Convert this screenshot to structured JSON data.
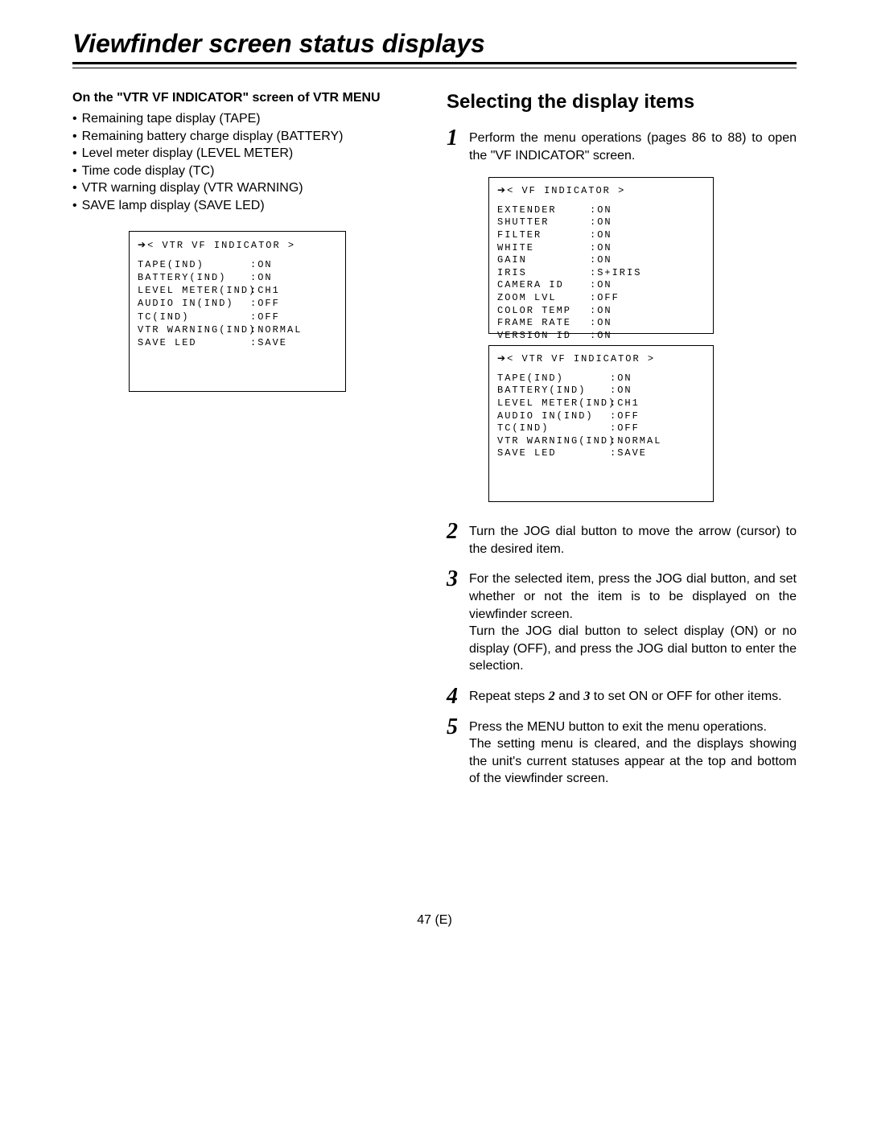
{
  "title": "Viewfinder screen status displays",
  "left": {
    "heading": "On the \"VTR VF INDICATOR\" screen of VTR MENU",
    "bullets": [
      "Remaining tape display (TAPE)",
      "Remaining battery charge display (BATTERY)",
      "Level meter display (LEVEL METER)",
      "Time code display (TC)",
      "VTR warning display (VTR WARNING)",
      "SAVE lamp display (SAVE LED)"
    ],
    "menu": {
      "title": "< VTR VF INDICATOR >",
      "rows": [
        {
          "l": "TAPE(IND)",
          "v": ":ON"
        },
        {
          "l": "BATTERY(IND)",
          "v": ":ON"
        },
        {
          "l": "LEVEL METER(IND)",
          "v": ":CH1"
        },
        {
          "l": "AUDIO IN(IND)",
          "v": ":OFF"
        },
        {
          "l": "TC(IND)",
          "v": ":OFF"
        },
        {
          "l": "VTR WARNING(IND)",
          "v": ":NORMAL"
        },
        {
          "l": "SAVE LED",
          "v": ":SAVE"
        }
      ]
    }
  },
  "right": {
    "heading": "Selecting the display items",
    "step1": "Perform the menu operations (pages 86 to 88) to open the \"VF INDICATOR\" screen.",
    "menu1": {
      "title": "< VF INDICATOR >",
      "rows": [
        {
          "l": "EXTENDER",
          "v": ":ON"
        },
        {
          "l": "SHUTTER",
          "v": ":ON"
        },
        {
          "l": "FILTER",
          "v": ":ON"
        },
        {
          "l": "WHITE",
          "v": ":ON"
        },
        {
          "l": "GAIN",
          "v": ":ON"
        },
        {
          "l": "IRIS",
          "v": ":S+IRIS"
        },
        {
          "l": "CAMERA ID",
          "v": ":ON"
        },
        {
          "l": "ZOOM LVL",
          "v": ":OFF"
        },
        {
          "l": "COLOR TEMP",
          "v": ":ON"
        },
        {
          "l": "FRAME RATE",
          "v": ":ON"
        },
        {
          "l": "VERSION ID",
          "v": ":ON"
        }
      ]
    },
    "menu2": {
      "title": "< VTR VF INDICATOR >",
      "rows": [
        {
          "l": "TAPE(IND)",
          "v": ":ON"
        },
        {
          "l": "BATTERY(IND)",
          "v": ":ON"
        },
        {
          "l": "LEVEL METER(IND)",
          "v": ":CH1"
        },
        {
          "l": "AUDIO IN(IND)",
          "v": ":OFF"
        },
        {
          "l": "TC(IND)",
          "v": ":OFF"
        },
        {
          "l": "VTR WARNING(IND)",
          "v": ":NORMAL"
        },
        {
          "l": "SAVE LED",
          "v": ":SAVE"
        }
      ]
    },
    "step2": "Turn the JOG dial button to move the arrow (cursor) to the desired item.",
    "step3a": "For the selected item, press the JOG dial button, and set whether or not the item is to be displayed on the viewfinder screen.",
    "step3b": "Turn the JOG dial button to select display (ON) or no display (OFF), and press the JOG dial button to enter the selection.",
    "step4_pre": "Repeat steps ",
    "step4_n2": "2",
    "step4_mid": " and ",
    "step4_n3": "3",
    "step4_post": " to set ON or OFF for other items.",
    "step5a": "Press the MENU button to exit the menu operations.",
    "step5b": "The setting menu is cleared, and the displays showing the unit's current statuses appear at the top and bottom of the viewfinder screen."
  },
  "page_num": "47 (E)"
}
